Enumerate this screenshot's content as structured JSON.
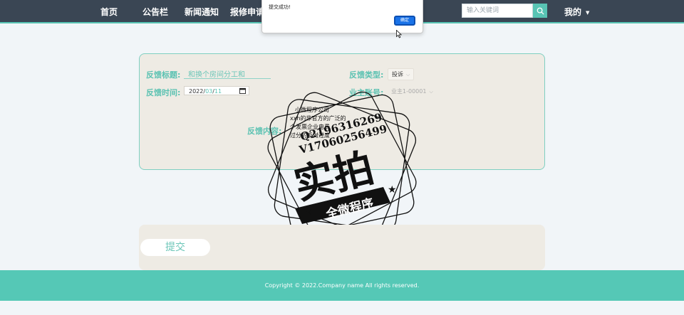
{
  "nav": {
    "items": [
      "首页",
      "公告栏",
      "新闻通知",
      "报修申请"
    ],
    "search_placeholder": "输入关键词",
    "mine_label": "我的"
  },
  "alert": {
    "message": "提交成功!",
    "ok_label": "确定"
  },
  "form": {
    "title_label": "反馈标题:",
    "title_value": "和换个房间分工和",
    "type_label": "反馈类型:",
    "type_value": "投诉",
    "time_label": "反馈时间:",
    "date_year": "2022",
    "date_month": "03",
    "date_day": "11",
    "date_sep": "/",
    "owner_label": "业主账号:",
    "owner_value": "业主1-00001",
    "content_label": "反馈内容:"
  },
  "watermark": {
    "line1": "小微程序公司",
    "line2": "xxh的非官方的广泛的",
    "line3": "个发票企业电费",
    "line4": "过分的反对过度",
    "code1": "Q2196316269",
    "code2": "V17060256499",
    "big": "实拍",
    "band": "全微程序"
  },
  "submit_label": "提交",
  "footer_text": "Copyright © 2022.Company name All rights reserved.",
  "colors": {
    "nav_bg": "#3a4654",
    "accent": "#58c4b4",
    "panel_bg": "#eeebe4",
    "footer_bg": "#55c8b6"
  }
}
